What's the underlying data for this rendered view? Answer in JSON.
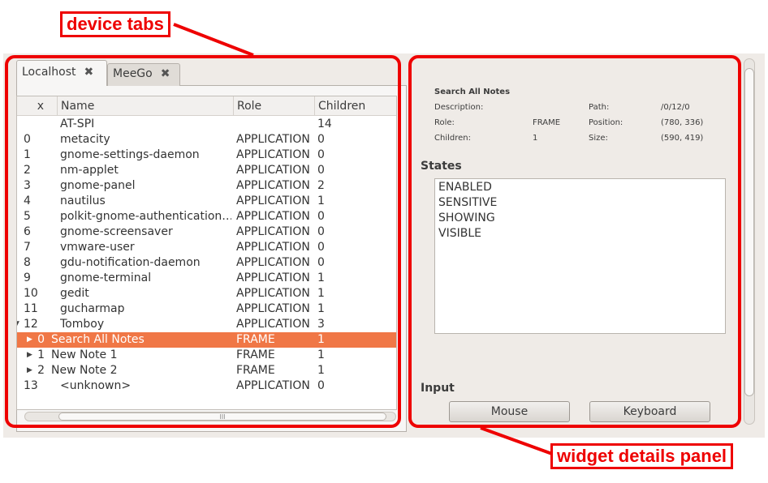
{
  "annotations": {
    "device_tabs": "device tabs",
    "widget_details_panel": "widget details panel"
  },
  "tabs": [
    {
      "label": "Localhost",
      "close_icon": "close-icon",
      "active": true
    },
    {
      "label": "MeeGo",
      "close_icon": "close-icon",
      "active": false
    }
  ],
  "tree": {
    "columns": [
      "x",
      "Name",
      "Role",
      "Children"
    ],
    "rows": [
      {
        "index": "",
        "name": "AT-SPI",
        "role": "",
        "children": "14",
        "expander": ""
      },
      {
        "index": "0",
        "name": "metacity",
        "role": "APPLICATION",
        "children": "0",
        "expander": ""
      },
      {
        "index": "1",
        "name": "gnome-settings-daemon",
        "role": "APPLICATION",
        "children": "0",
        "expander": ""
      },
      {
        "index": "2",
        "name": "nm-applet",
        "role": "APPLICATION",
        "children": "0",
        "expander": ""
      },
      {
        "index": "3",
        "name": "gnome-panel",
        "role": "APPLICATION",
        "children": "2",
        "expander": ""
      },
      {
        "index": "4",
        "name": "nautilus",
        "role": "APPLICATION",
        "children": "1",
        "expander": ""
      },
      {
        "index": "5",
        "name": "polkit-gnome-authentication…",
        "role": "APPLICATION",
        "children": "0",
        "expander": ""
      },
      {
        "index": "6",
        "name": "gnome-screensaver",
        "role": "APPLICATION",
        "children": "0",
        "expander": ""
      },
      {
        "index": "7",
        "name": "vmware-user",
        "role": "APPLICATION",
        "children": "0",
        "expander": ""
      },
      {
        "index": "8",
        "name": "gdu-notification-daemon",
        "role": "APPLICATION",
        "children": "0",
        "expander": ""
      },
      {
        "index": "9",
        "name": "gnome-terminal",
        "role": "APPLICATION",
        "children": "1",
        "expander": ""
      },
      {
        "index": "10",
        "name": "gedit",
        "role": "APPLICATION",
        "children": "1",
        "expander": ""
      },
      {
        "index": "11",
        "name": "gucharmap",
        "role": "APPLICATION",
        "children": "1",
        "expander": ""
      },
      {
        "index": "12",
        "name": "Tomboy",
        "role": "APPLICATION",
        "children": "3",
        "expander": "▼"
      },
      {
        "index": "0",
        "name": "Search All Notes",
        "role": "FRAME",
        "children": "1",
        "expander": "▶",
        "selected": true
      },
      {
        "index": "1",
        "name": "New Note 1",
        "role": "FRAME",
        "children": "1",
        "expander": "▶"
      },
      {
        "index": "2",
        "name": "New Note 2",
        "role": "FRAME",
        "children": "1",
        "expander": "▶"
      },
      {
        "index": "13",
        "name": "<unknown>",
        "role": "APPLICATION",
        "children": "0",
        "expander": ""
      }
    ],
    "scroll_grip": "III"
  },
  "details": {
    "title": "Search All Notes",
    "description_label": "Description:",
    "role_label": "Role:",
    "role_value": "FRAME",
    "children_label": "Children:",
    "children_value": "1",
    "path_label": "Path:",
    "path_value": "/0/12/0",
    "position_label": "Position:",
    "position_value": "(780, 336)",
    "size_label": "Size:",
    "size_value": "(590, 419)"
  },
  "states": {
    "title": "States",
    "items": [
      "ENABLED",
      "SENSITIVE",
      "SHOWING",
      "VISIBLE"
    ]
  },
  "input": {
    "title": "Input",
    "mouse_label": "Mouse",
    "keyboard_label": "Keyboard"
  },
  "colors": {
    "selection": "#f07746",
    "annotation": "#ee0000"
  }
}
